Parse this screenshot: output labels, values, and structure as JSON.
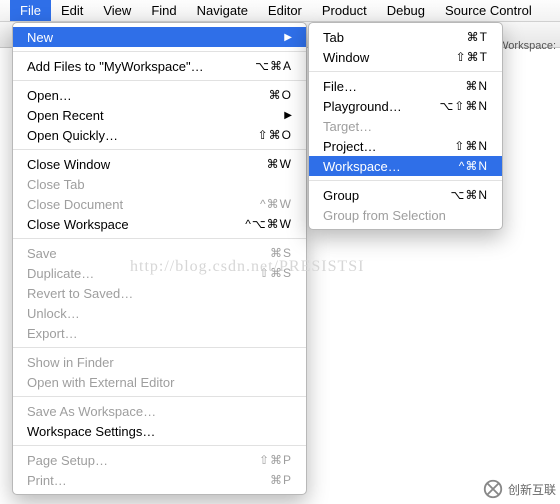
{
  "menubar": {
    "items": [
      "File",
      "Edit",
      "View",
      "Find",
      "Navigate",
      "Editor",
      "Product",
      "Debug",
      "Source Control"
    ],
    "selected": "File"
  },
  "remark": "Workspace: ",
  "menu": {
    "groups": [
      [
        {
          "id": "new",
          "label": "New",
          "enabled": true,
          "selected": true,
          "submenu": true,
          "kc": ""
        }
      ],
      [
        {
          "id": "add-files",
          "label": "Add Files to \"MyWorkspace\"…",
          "enabled": true,
          "kc": "⌥⌘A"
        }
      ],
      [
        {
          "id": "open",
          "label": "Open…",
          "enabled": true,
          "kc": "⌘O"
        },
        {
          "id": "open-recent",
          "label": "Open Recent",
          "enabled": true,
          "submenu": true,
          "kc": ""
        },
        {
          "id": "open-quickly",
          "label": "Open Quickly…",
          "enabled": true,
          "kc": "⇧⌘O"
        }
      ],
      [
        {
          "id": "close-window",
          "label": "Close Window",
          "enabled": true,
          "kc": "⌘W"
        },
        {
          "id": "close-tab",
          "label": "Close Tab",
          "enabled": false,
          "kc": ""
        },
        {
          "id": "close-document",
          "label": "Close Document",
          "enabled": false,
          "kc": "^⌘W"
        },
        {
          "id": "close-workspace",
          "label": "Close Workspace",
          "enabled": true,
          "kc": "^⌥⌘W"
        }
      ],
      [
        {
          "id": "save",
          "label": "Save",
          "enabled": false,
          "kc": "⌘S"
        },
        {
          "id": "duplicate",
          "label": "Duplicate…",
          "enabled": false,
          "kc": "⇧⌘S"
        },
        {
          "id": "revert",
          "label": "Revert to Saved…",
          "enabled": false,
          "kc": ""
        },
        {
          "id": "unlock",
          "label": "Unlock…",
          "enabled": false,
          "kc": ""
        },
        {
          "id": "export",
          "label": "Export…",
          "enabled": false,
          "kc": ""
        }
      ],
      [
        {
          "id": "show-finder",
          "label": "Show in Finder",
          "enabled": false,
          "kc": ""
        },
        {
          "id": "open-external",
          "label": "Open with External Editor",
          "enabled": false,
          "kc": ""
        }
      ],
      [
        {
          "id": "save-as-ws",
          "label": "Save As Workspace…",
          "enabled": false,
          "kc": ""
        },
        {
          "id": "ws-settings",
          "label": "Workspace Settings…",
          "enabled": true,
          "kc": ""
        }
      ],
      [
        {
          "id": "page-setup",
          "label": "Page Setup…",
          "enabled": false,
          "kc": "⇧⌘P"
        },
        {
          "id": "print",
          "label": "Print…",
          "enabled": false,
          "kc": "⌘P"
        }
      ]
    ]
  },
  "submenu": {
    "groups": [
      [
        {
          "id": "tab",
          "label": "Tab",
          "enabled": true,
          "kc": "⌘T"
        },
        {
          "id": "window",
          "label": "Window",
          "enabled": true,
          "kc": "⇧⌘T"
        }
      ],
      [
        {
          "id": "file",
          "label": "File…",
          "enabled": true,
          "kc": "⌘N"
        },
        {
          "id": "playground",
          "label": "Playground…",
          "enabled": true,
          "kc": "⌥⇧⌘N"
        },
        {
          "id": "target",
          "label": "Target…",
          "enabled": false,
          "kc": ""
        },
        {
          "id": "project",
          "label": "Project…",
          "enabled": true,
          "kc": "⇧⌘N"
        },
        {
          "id": "workspace",
          "label": "Workspace…",
          "enabled": true,
          "selected": true,
          "kc": "^⌘N"
        }
      ],
      [
        {
          "id": "group",
          "label": "Group",
          "enabled": true,
          "kc": "⌥⌘N"
        },
        {
          "id": "group-sel",
          "label": "Group from Selection",
          "enabled": false,
          "kc": ""
        }
      ]
    ]
  },
  "watermark": "http://blog.csdn.net/PRESISTSI",
  "logo": "创新互联"
}
